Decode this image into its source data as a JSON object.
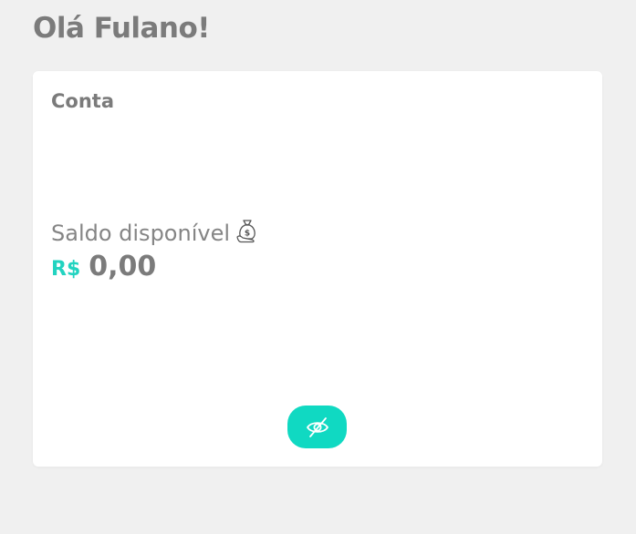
{
  "greeting": "Olá Fulano!",
  "card": {
    "title": "Conta",
    "balance_label": "Saldo disponível",
    "currency": "R$",
    "amount": "0,00"
  },
  "icons": {
    "balance_icon": "money-bag-icon",
    "toggle_icon": "eye-slash-icon"
  },
  "colors": {
    "background": "#f0f0f0",
    "card": "#ffffff",
    "accent": "#10d9c2",
    "text": "#7b7b7b"
  }
}
